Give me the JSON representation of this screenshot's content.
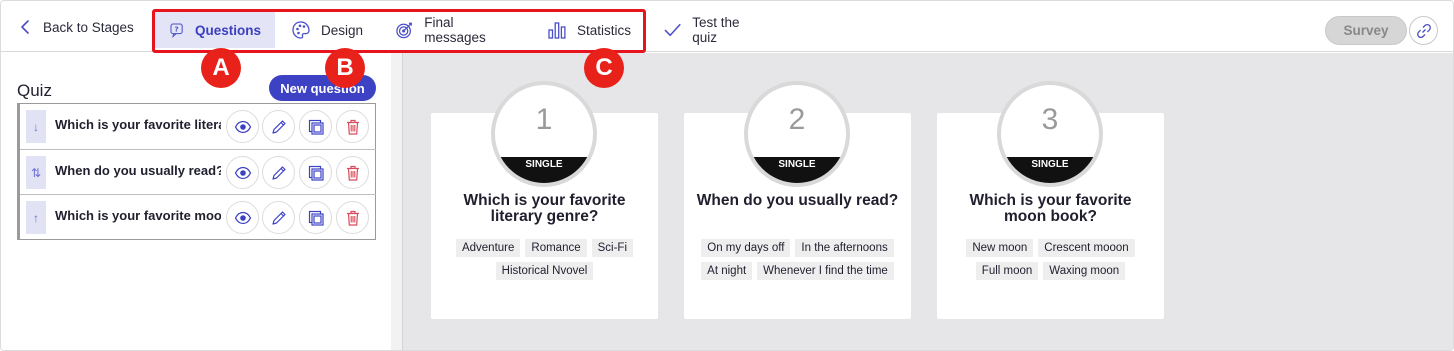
{
  "topbar": {
    "back_label": "Back to Stages",
    "tabs": [
      {
        "label": "Questions",
        "icon": "question-bubble-icon"
      },
      {
        "label": "Design",
        "icon": "palette-icon"
      },
      {
        "label": "Final messages",
        "icon": "target-icon"
      },
      {
        "label": "Statistics",
        "icon": "bar-chart-icon"
      },
      {
        "label": "Test the quiz",
        "icon": "checkmark-icon"
      }
    ],
    "active_tab": "Questions",
    "survey_label": "Survey",
    "link_icon": "link-icon"
  },
  "markers": [
    "A",
    "B",
    "C"
  ],
  "sidebar": {
    "title": "Quiz",
    "new_question_label": "New question",
    "questions": [
      {
        "order_icon": "↓",
        "text": "Which is your favorite literary genre?"
      },
      {
        "order_icon": "⇅",
        "text": "When do you usually read?"
      },
      {
        "order_icon": "↑",
        "text": "Which is your favorite moon book?"
      }
    ],
    "row_actions": [
      "eye-icon",
      "pencil-icon",
      "duplicate-icon",
      "trash-icon"
    ]
  },
  "cards": [
    {
      "number": "1",
      "type": "SINGLE",
      "title": "Which is your favorite literary genre?",
      "options": [
        "Adventure",
        "Romance",
        "Sci-Fi",
        "Historical Nvovel"
      ]
    },
    {
      "number": "2",
      "type": "SINGLE",
      "title": "When do you usually read?",
      "options": [
        "On my days off",
        "In the afternoons",
        "At night",
        "Whenever I find the time"
      ]
    },
    {
      "number": "3",
      "type": "SINGLE",
      "title": "Which is your favorite moon book?",
      "options": [
        "New moon",
        "Crescent mooon",
        "Full moon",
        "Waxing moon"
      ]
    }
  ],
  "colors": {
    "accent": "#3d41c4",
    "active_tab_bg": "#e3e5f6",
    "marker_red": "#e8211a",
    "delete_red": "#d94a5a",
    "canvas_bg": "#e6e6e9"
  }
}
